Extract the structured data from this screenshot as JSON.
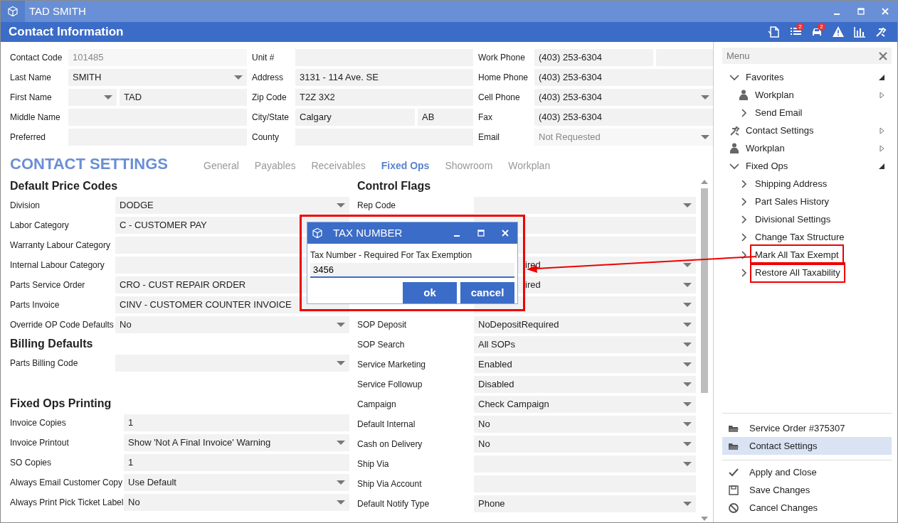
{
  "window": {
    "title": "TAD SMITH"
  },
  "header": {
    "title": "Contact Information",
    "tools": [
      {
        "kind": "export"
      },
      {
        "kind": "list",
        "badge": "2"
      },
      {
        "kind": "car",
        "badge": "2"
      },
      {
        "kind": "warning"
      },
      {
        "kind": "chart"
      },
      {
        "kind": "tool"
      }
    ]
  },
  "contact": {
    "columns": [
      [
        {
          "label": "Contact Code",
          "fields": [
            {
              "value": "101485",
              "dropdown": false,
              "disabled": true
            }
          ]
        },
        {
          "label": "Last Name",
          "fields": [
            {
              "value": "SMITH",
              "dropdown": true,
              "disabled": false
            }
          ]
        },
        {
          "label": "First Name",
          "fields": [
            {
              "dropdown": true
            },
            {
              "value": "TAD",
              "dropdown": false,
              "disabled": false
            }
          ]
        },
        {
          "label": "Middle Name",
          "fields": [
            {
              "dropdown": false
            }
          ]
        },
        {
          "label": "Preferred",
          "fields": [
            {
              "dropdown": false
            }
          ]
        }
      ],
      [
        {
          "label": "Unit #",
          "fields": [
            {
              "dropdown": false
            }
          ]
        },
        {
          "label": "Address",
          "fields": [
            {
              "value": "3131 - 114 Ave. SE",
              "dropdown": false,
              "disabled": false
            }
          ]
        },
        {
          "label": "Zip Code",
          "fields": [
            {
              "value": "T2Z 3X2",
              "dropdown": false,
              "disabled": false
            }
          ]
        },
        {
          "label": "City/State",
          "fields": [
            {
              "value": "Calgary",
              "dropdown": false,
              "disabled": false
            },
            {
              "value": "AB",
              "dropdown": false,
              "disabled": false
            }
          ]
        },
        {
          "label": "County",
          "fields": [
            {
              "dropdown": false
            }
          ]
        }
      ],
      [
        {
          "label": "Work Phone",
          "fields": [
            {
              "value": "(403) 253-6304",
              "dropdown": false,
              "disabled": false
            },
            {
              "dropdown": false
            }
          ]
        },
        {
          "label": "Home Phone",
          "fields": [
            {
              "value": "(403) 253-6304",
              "dropdown": false,
              "disabled": false
            }
          ]
        },
        {
          "label": "Cell Phone",
          "fields": [
            {
              "value": "(403) 253-6304",
              "dropdown": true,
              "disabled": false
            }
          ]
        },
        {
          "label": "Fax",
          "fields": [
            {
              "value": "(403) 253-6304",
              "dropdown": false,
              "disabled": false
            }
          ]
        },
        {
          "label": "Email",
          "fields": [
            {
              "value": "Not Requested",
              "dropdown": true,
              "disabled": true
            }
          ]
        }
      ]
    ]
  },
  "settings": {
    "title": "CONTACT SETTINGS",
    "tabs": [
      {
        "label": "General",
        "selected": false
      },
      {
        "label": "Payables",
        "selected": false
      },
      {
        "label": "Receivables",
        "selected": false
      },
      {
        "label": "Fixed Ops",
        "selected": true
      },
      {
        "label": "Showroom",
        "selected": false
      },
      {
        "label": "Workplan",
        "selected": false
      }
    ],
    "left_sections": [
      {
        "title": "Default Price Codes",
        "rows": [
          {
            "label": "Division",
            "value": "DODGE",
            "dropdown": true
          },
          {
            "label": "Labor Category",
            "value": "C - CUSTOMER PAY"
          },
          {
            "label": "Warranty Labour Category"
          },
          {
            "label": "Internal Labour Category"
          },
          {
            "label": "Parts Service Order",
            "value": "CRO - CUST REPAIR ORDER"
          },
          {
            "label": "Parts Invoice",
            "value": "CINV - CUSTOMER COUNTER INVOICE",
            "dropdown": false
          },
          {
            "label": "Override OP Code Defaults",
            "value": "No",
            "dropdown": true
          }
        ]
      },
      {
        "title": "Billing Defaults",
        "rows": [
          {
            "label": "Parts Billing Code",
            "dropdown": true
          }
        ]
      },
      {
        "title": "Fixed Ops Printing",
        "rows": [
          {
            "label": "Invoice Copies",
            "value": "1",
            "dropdown": false
          },
          {
            "label": "Invoice Printout",
            "value": "Show 'Not A Final Invoice' Warning",
            "dropdown": true
          },
          {
            "label": "SO Copies",
            "value": "1",
            "dropdown": false
          },
          {
            "label": "Always Email Customer Copy",
            "value": "Use Default",
            "dropdown": true
          },
          {
            "label": "Always Print Pick Ticket Label",
            "value": "No",
            "dropdown": true
          }
        ]
      }
    ],
    "right_sections": [
      {
        "title": "Control Flags",
        "rows": [
          {
            "label": "Rep Code",
            "dropdown": true
          },
          {
            "dropdown": false
          },
          {
            "dropdown": false
          },
          {
            "value": "ired",
            "dropdown": true,
            "covered": true
          },
          {
            "value": "ired",
            "dropdown": true,
            "covered": true
          },
          {
            "dropdown": true
          },
          {
            "label": "SOP Deposit",
            "value": "NoDepositRequired",
            "dropdown": true
          },
          {
            "label": "SOP Search",
            "value": "All SOPs",
            "dropdown": true
          },
          {
            "label": "Service Marketing",
            "value": "Enabled",
            "dropdown": true
          },
          {
            "label": "Service Followup",
            "value": "Disabled",
            "dropdown": true
          },
          {
            "label": "Campaign",
            "value": "Check Campaign",
            "dropdown": true
          },
          {
            "label": "Default Internal",
            "value": "No",
            "dropdown": true
          },
          {
            "label": "Cash on Delivery",
            "value": "No",
            "dropdown": true
          },
          {
            "label": "Ship Via",
            "dropdown": true
          },
          {
            "label": "Ship Via Account",
            "dropdown": false
          },
          {
            "label": "Default Notify Type",
            "value": "Phone",
            "dropdown": true
          }
        ]
      }
    ]
  },
  "dialog": {
    "title": "TAX NUMBER",
    "label": "Tax Number - Required For Tax Exemption",
    "value": "3456",
    "buttons": [
      "ok",
      "cancel"
    ]
  },
  "menu": {
    "title": "Menu",
    "items": [
      {
        "label": "Favorites",
        "kind": "group",
        "expanded": true,
        "annotated": false,
        "children": [
          {
            "label": "Workplan",
            "kind": "person-submenu",
            "annotated": false
          },
          {
            "label": "Send Email",
            "kind": "link",
            "annotated": false
          }
        ]
      },
      {
        "label": "Contact Settings",
        "kind": "tool-submenu",
        "annotated": false
      },
      {
        "label": "Workplan",
        "kind": "person-submenu",
        "annotated": false
      },
      {
        "label": "Fixed Ops",
        "kind": "group",
        "expanded": true,
        "annotated": false,
        "children": [
          {
            "label": "Shipping Address",
            "kind": "link",
            "annotated": false
          },
          {
            "label": "Part Sales History",
            "kind": "link",
            "annotated": false
          },
          {
            "label": "Divisional Settings",
            "kind": "link",
            "annotated": false
          },
          {
            "label": "Change Tax Structure",
            "kind": "link",
            "annotated": false
          },
          {
            "label": "Mark All Tax Exempt",
            "kind": "link",
            "annotated": true
          },
          {
            "label": "Restore All Taxability",
            "kind": "link",
            "annotated": true
          }
        ]
      }
    ],
    "windows": [
      {
        "label": "Service Order #375307",
        "selected": false
      },
      {
        "label": "Contact Settings",
        "selected": true
      }
    ],
    "actions": [
      {
        "label": "Apply and Close",
        "kind": "apply"
      },
      {
        "label": "Save Changes",
        "kind": "save"
      },
      {
        "label": "Cancel Changes",
        "kind": "cancel"
      }
    ]
  }
}
